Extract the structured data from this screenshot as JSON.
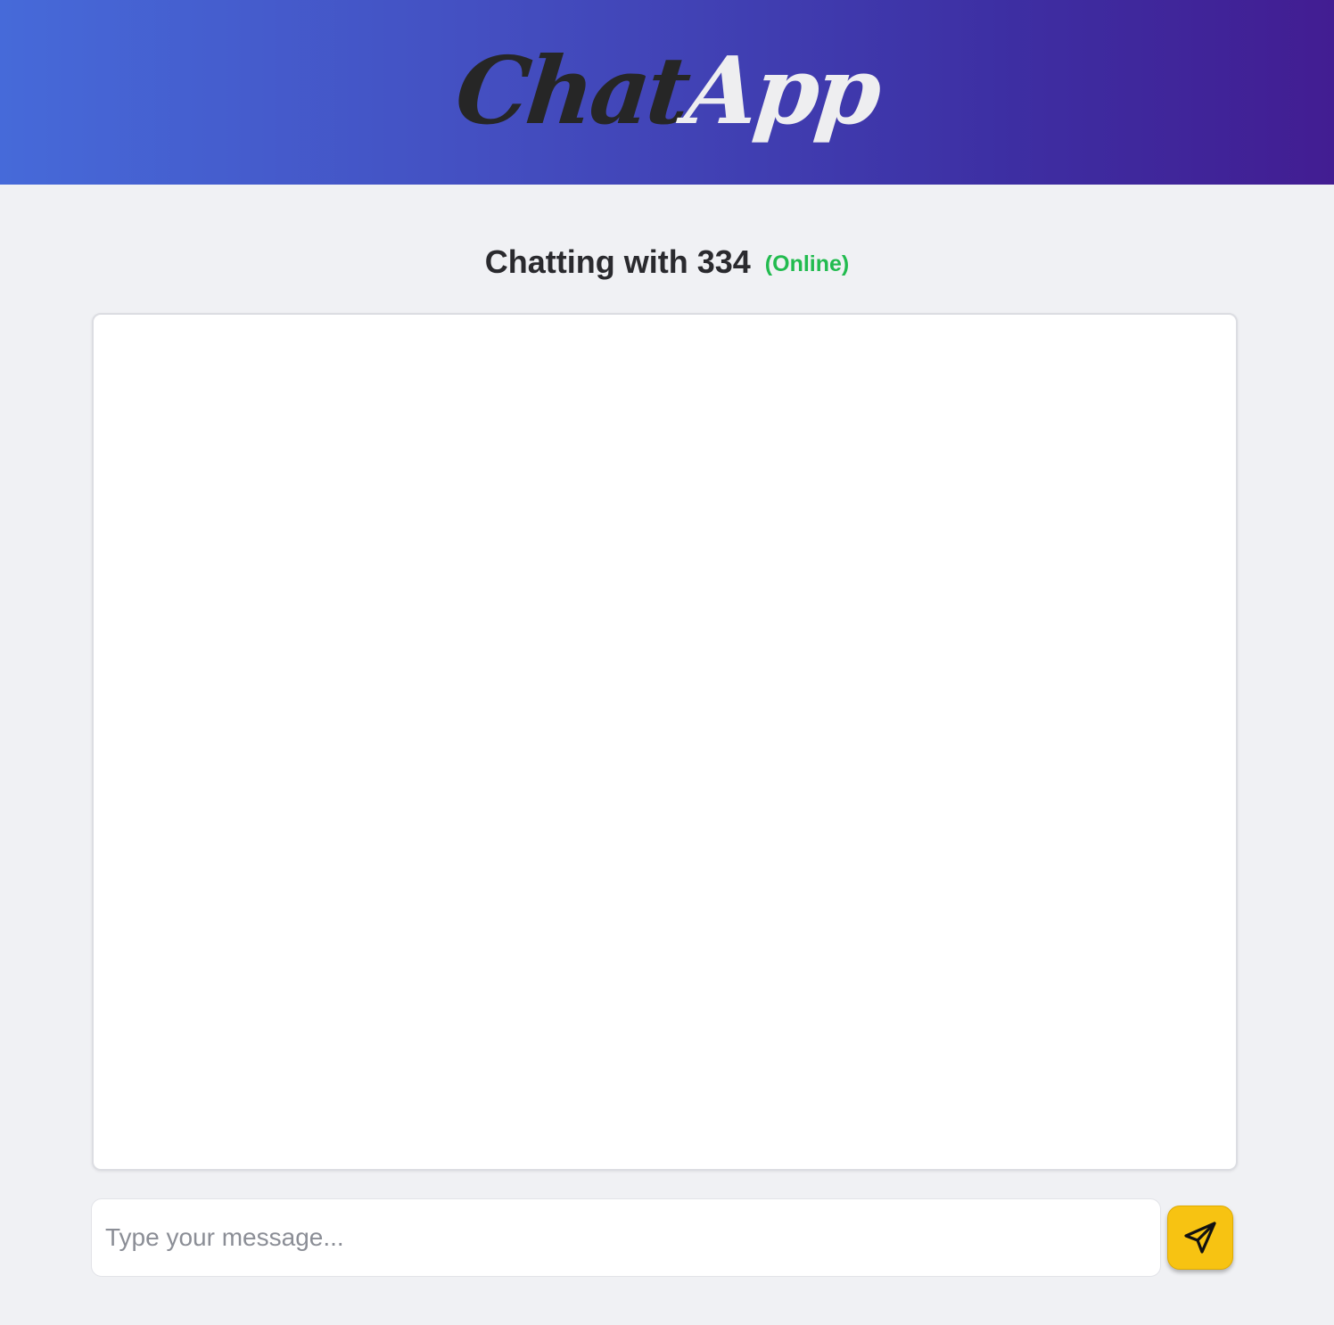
{
  "header": {
    "logo_part1": "Chat",
    "logo_part2": "App",
    "gradient_start": "#466ad9",
    "gradient_end": "#421d92"
  },
  "chat": {
    "title": "Chatting with 334",
    "status": "(Online)",
    "status_color": "#22bb4f",
    "messages": []
  },
  "composer": {
    "placeholder": "Type your message...",
    "value": "",
    "send_icon": "send-icon",
    "send_button_color": "#f7c312"
  }
}
